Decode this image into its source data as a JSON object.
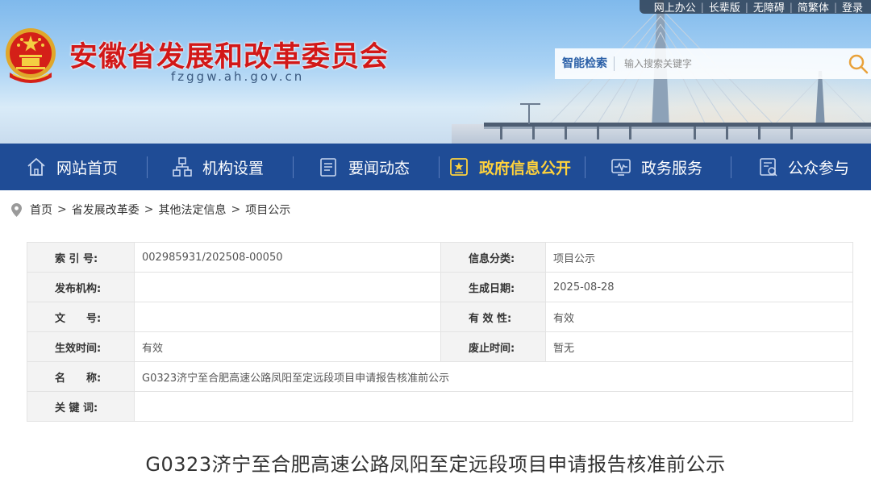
{
  "header": {
    "site_title": "安徽省发展和改革委员会",
    "site_domain": "fzggw.ah.gov.cn",
    "top_links": [
      "网上办公",
      "长辈版",
      "无障碍",
      "简繁体",
      "登录"
    ],
    "search": {
      "label": "智能检索",
      "placeholder": "输入搜索关键字"
    }
  },
  "nav": {
    "items": [
      {
        "label": "网站首页",
        "icon": "home-icon"
      },
      {
        "label": "机构设置",
        "icon": "org-chart-icon"
      },
      {
        "label": "要闻动态",
        "icon": "news-icon"
      },
      {
        "label": "政府信息公开",
        "icon": "info-open-icon",
        "active": true
      },
      {
        "label": "政务服务",
        "icon": "service-icon"
      },
      {
        "label": "公众参与",
        "icon": "participation-icon"
      }
    ],
    "active_color": "#ffd23c",
    "bar_color": "#1f4c96"
  },
  "breadcrumb": [
    "首页",
    "省发展改革委",
    "其他法定信息",
    "项目公示"
  ],
  "info": {
    "index_label": "索 引 号:",
    "index_value": "002985931/202508-00050",
    "category_label": "信息分类:",
    "category_value": "项目公示",
    "publisher_label": "发布机构:",
    "publisher_value": "",
    "date_label": "生成日期:",
    "date_value": "2025-08-28",
    "doc_no_label": "文　　号:",
    "doc_no_value": "",
    "validity_label": "有 效 性:",
    "validity_value": "有效",
    "effective_label": "生效时间:",
    "effective_value": "有效",
    "abolish_label": "废止时间:",
    "abolish_value": "暂无",
    "name_label": "名　　称:",
    "name_value": "G0323济宁至合肥高速公路凤阳至定远段项目申请报告核准前公示",
    "keywords_label": "关 键 词:",
    "keywords_value": ""
  },
  "article": {
    "title": "G0323济宁至合肥高速公路凤阳至定远段项目申请报告核准前公示"
  }
}
